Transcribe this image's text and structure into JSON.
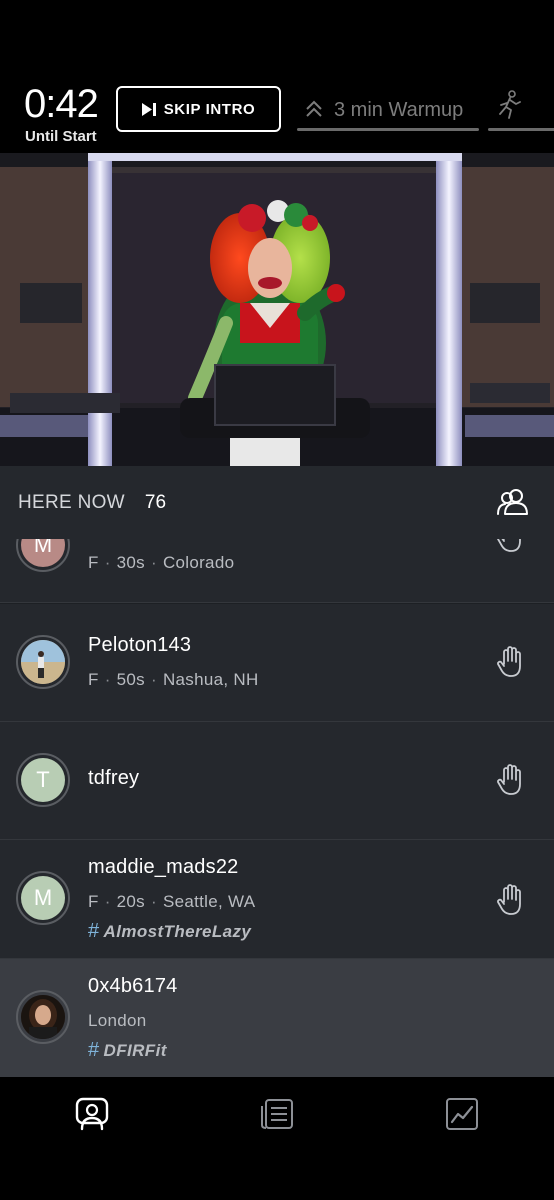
{
  "header": {
    "timer": "0:42",
    "until_label": "Until Start",
    "skip_label": "SKIP INTRO",
    "segment_label": "3 min Warmup"
  },
  "here_now": {
    "label": "HERE NOW",
    "count": "76"
  },
  "riders": [
    {
      "initial": "M",
      "username": "",
      "gender": "F",
      "age": "30s",
      "location": "Colorado",
      "tag": ""
    },
    {
      "initial": "",
      "username": "Peloton143",
      "gender": "F",
      "age": "50s",
      "location": "Nashua, NH",
      "tag": ""
    },
    {
      "initial": "T",
      "username": "tdfrey",
      "gender": "",
      "age": "",
      "location": "",
      "tag": ""
    },
    {
      "initial": "M",
      "username": "maddie_mads22",
      "gender": "F",
      "age": "20s",
      "location": "Seattle, WA",
      "tag": "AlmostThereLazy"
    },
    {
      "initial": "",
      "username": "0x4b6174",
      "gender": "",
      "age": "",
      "location": "London",
      "tag": "DFIRFit"
    }
  ],
  "icons": {
    "skip": "skip-forward-icon",
    "segment": "chevrons-up-icon",
    "run": "running-person-icon",
    "group": "group-icon",
    "hand": "high-five-hand-icon",
    "nav": [
      "leaderboard-person-icon",
      "class-plan-icon",
      "metrics-graph-icon"
    ]
  },
  "colors": {
    "row_bg": "#25282d",
    "highlight_row_bg": "#3a3d43",
    "hashtag": "#7fb3d9"
  }
}
